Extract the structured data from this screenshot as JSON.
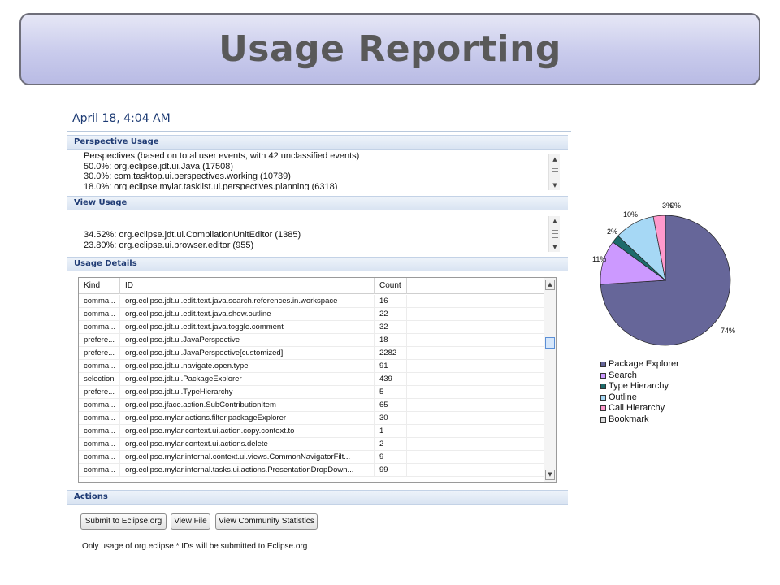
{
  "slide": {
    "title": "Usage Reporting"
  },
  "panel": {
    "date": "April 18, 4:04 AM",
    "perspective_usage": {
      "title": "Perspective Usage",
      "lines": [
        "Perspectives (based on total user events, with 42 unclassified events)",
        "50.0%: org.eclipse.jdt.ui.Java (17508)",
        "30.0%: com.tasktop.ui.perspectives.working (10739)",
        "18.0%: org.eclipse.mylar.tasklist.ui.perspectives.planning (6318)"
      ]
    },
    "view_usage": {
      "title": "View Usage",
      "lines": [
        "34.52%: org.eclipse.jdt.ui.CompilationUnitEditor (1385)",
        "23.80%: org.eclipse.ui.browser.editor (955)"
      ]
    },
    "usage_details": {
      "title": "Usage Details",
      "columns": [
        "Kind",
        "ID",
        "Count"
      ],
      "rows": [
        [
          "comma...",
          "org.eclipse.jdt.ui.edit.text.java.search.references.in.workspace",
          "16"
        ],
        [
          "comma...",
          "org.eclipse.jdt.ui.edit.text.java.show.outline",
          "22"
        ],
        [
          "comma...",
          "org.eclipse.jdt.ui.edit.text.java.toggle.comment",
          "32"
        ],
        [
          "prefere...",
          "org.eclipse.jdt.ui.JavaPerspective",
          "18"
        ],
        [
          "prefere...",
          "org.eclipse.jdt.ui.JavaPerspective[customized]",
          "2282"
        ],
        [
          "comma...",
          "org.eclipse.jdt.ui.navigate.open.type",
          "91"
        ],
        [
          "selection",
          "org.eclipse.jdt.ui.PackageExplorer",
          "439"
        ],
        [
          "prefere...",
          "org.eclipse.jdt.ui.TypeHierarchy",
          "5"
        ],
        [
          "comma...",
          "org.eclipse.jface.action.SubContributionItem",
          "65"
        ],
        [
          "comma...",
          "org.eclipse.mylar.actions.filter.packageExplorer",
          "30"
        ],
        [
          "comma...",
          "org.eclipse.mylar.context.ui.action.copy.context.to",
          "1"
        ],
        [
          "comma...",
          "org.eclipse.mylar.context.ui.actions.delete",
          "2"
        ],
        [
          "comma...",
          "org.eclipse.mylar.internal.context.ui.views.CommonNavigatorFilt...",
          "9"
        ],
        [
          "comma...",
          "org.eclipse.mylar.internal.tasks.ui.actions.PresentationDropDown...",
          "99"
        ]
      ]
    },
    "actions": {
      "title": "Actions",
      "buttons": [
        "Submit to Eclipse.org",
        "View File",
        "View Community Statistics"
      ],
      "note": "Only usage of org.eclipse.* IDs will be submitted to Eclipse.org"
    }
  },
  "chart_data": {
    "type": "pie",
    "title": "",
    "legend_position": "bottom-left",
    "slices": [
      {
        "name": "Package Explorer",
        "value": 74,
        "label": "74%",
        "color": "#666699"
      },
      {
        "name": "Search",
        "value": 11,
        "label": "11%",
        "color": "#cc99ff"
      },
      {
        "name": "Type Hierarchy",
        "value": 2,
        "label": "2%",
        "color": "#1d6b6b"
      },
      {
        "name": "Outline",
        "value": 10,
        "label": "10%",
        "color": "#a6d8f5"
      },
      {
        "name": "Call Hierarchy",
        "value": 3,
        "label": "3%",
        "color": "#ff99cc"
      },
      {
        "name": "Bookmark",
        "value": 0,
        "label": "0%",
        "color": "#dcdcdc"
      }
    ]
  }
}
